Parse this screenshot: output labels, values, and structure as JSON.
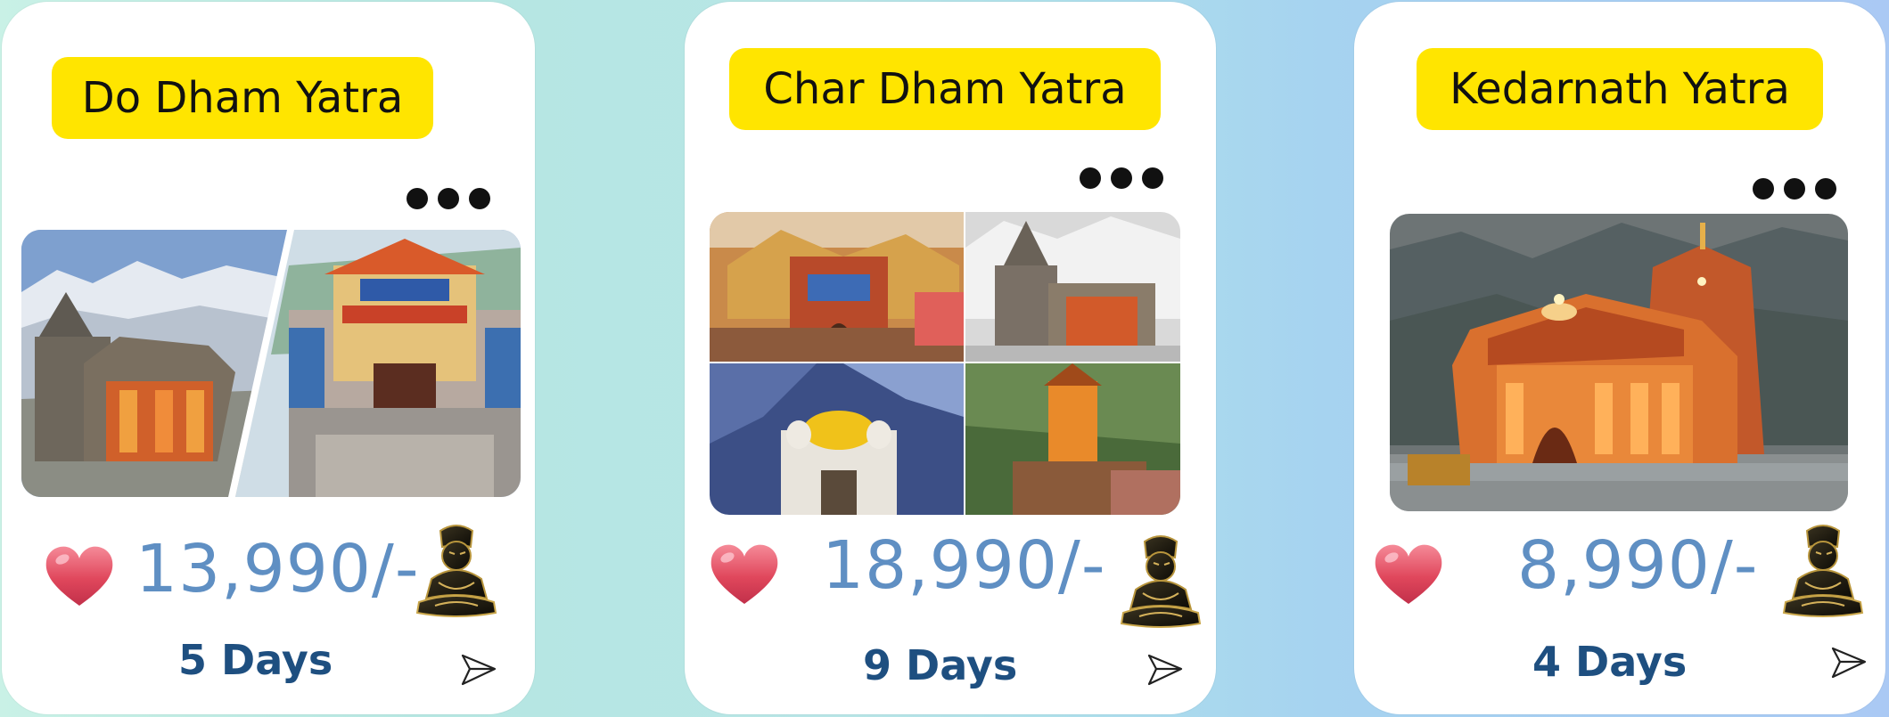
{
  "cards": [
    {
      "title": "Do Dham Yatra",
      "price": "13,990/-",
      "days": "5 Days",
      "photo": "collage-kedarnath-badrinath"
    },
    {
      "title": "Char Dham Yatra",
      "price": "18,990/-",
      "days": "9 Days",
      "photo": "four-temples-collage"
    },
    {
      "title": "Kedarnath Yatra",
      "price": "8,990/-",
      "days": "4 Days",
      "photo": "kedarnath-temple-night"
    }
  ],
  "icons": {
    "favorite": "heart-icon",
    "options": "more-options-icon",
    "share": "send-icon",
    "statue": "shiva-statue-icon"
  },
  "colors": {
    "title_background": "#ffe500",
    "price_text": "#5f8fc3",
    "days_text": "#1e4f80",
    "heart": "#e0475c"
  }
}
